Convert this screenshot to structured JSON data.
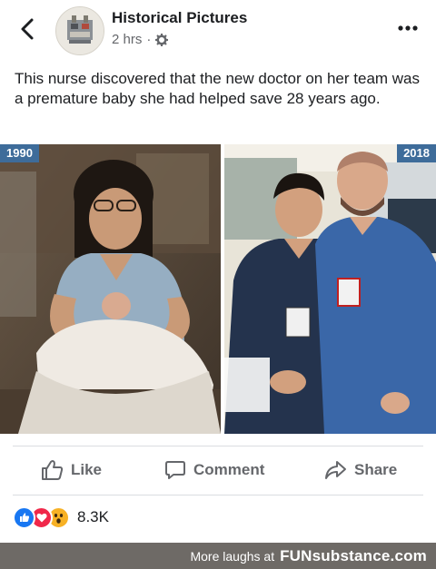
{
  "post": {
    "page_name": "Historical Pictures",
    "time": "2 hrs",
    "separator": "·",
    "caption": "This nurse discovered that the new doctor on her team was a premature baby she had helped save 28 years ago."
  },
  "photos": {
    "left_year": "1990",
    "right_year": "2018"
  },
  "actions": {
    "like": "Like",
    "comment": "Comment",
    "share": "Share"
  },
  "reactions": {
    "count": "8.3K",
    "types": [
      "like",
      "love",
      "wow"
    ]
  },
  "banner": {
    "text": "More laughs at",
    "site": "FUNsubstance.com"
  },
  "colors": {
    "like_blue": "#1877f2",
    "love_red": "#f0284a",
    "wow_yellow": "#f7b125",
    "year_badge": "#3e6c9a",
    "banner_bg": "#6e6a66"
  }
}
